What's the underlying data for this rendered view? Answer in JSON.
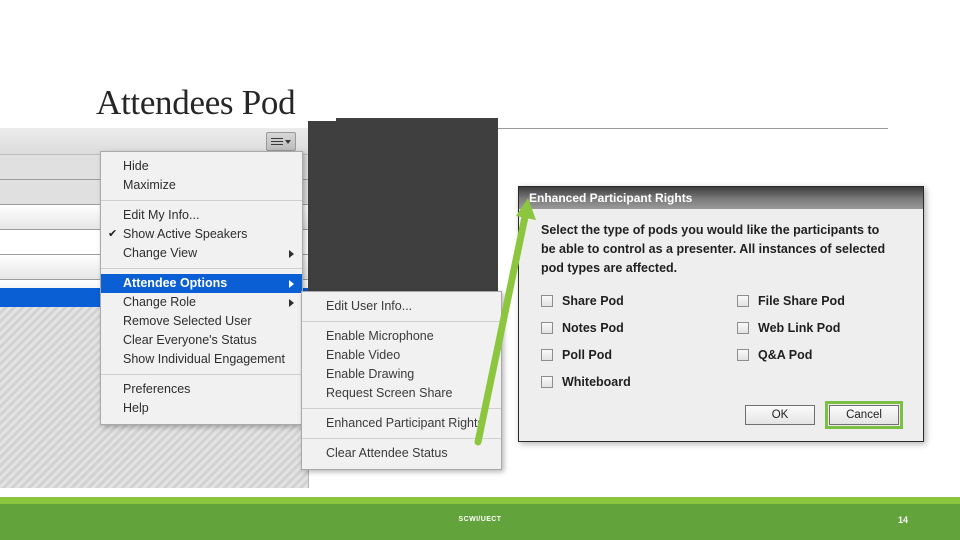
{
  "slide": {
    "title": "Attendees Pod",
    "page_number": "14",
    "footer_center": "SCWI/UECT",
    "accent_color": "#8cc63f",
    "footer_color": "#63a33b",
    "highlight_color": "#0b5fd4"
  },
  "pod_window": {
    "menu_button_icon": "hamburger-menu-icon"
  },
  "context_menu": {
    "groups": [
      {
        "items": [
          {
            "label": "Hide",
            "submenu": false,
            "checked": false,
            "selected": false
          },
          {
            "label": "Maximize",
            "submenu": false,
            "checked": false,
            "selected": false
          }
        ]
      },
      {
        "items": [
          {
            "label": "Edit My Info...",
            "submenu": false,
            "checked": false,
            "selected": false
          },
          {
            "label": "Show Active Speakers",
            "submenu": false,
            "checked": true,
            "selected": false
          },
          {
            "label": "Change View",
            "submenu": true,
            "checked": false,
            "selected": false
          }
        ]
      },
      {
        "items": [
          {
            "label": "Attendee Options",
            "submenu": true,
            "checked": false,
            "selected": true
          },
          {
            "label": "Change Role",
            "submenu": true,
            "checked": false,
            "selected": false
          },
          {
            "label": "Remove Selected User",
            "submenu": false,
            "checked": false,
            "selected": false
          },
          {
            "label": "Clear Everyone's Status",
            "submenu": false,
            "checked": false,
            "selected": false
          },
          {
            "label": "Show Individual Engagement",
            "submenu": false,
            "checked": false,
            "selected": false
          }
        ]
      },
      {
        "items": [
          {
            "label": "Preferences",
            "submenu": false,
            "checked": false,
            "selected": false
          },
          {
            "label": "Help",
            "submenu": false,
            "checked": false,
            "selected": false
          }
        ]
      }
    ]
  },
  "submenu": {
    "groups": [
      {
        "items": [
          {
            "label": "Edit User Info...",
            "submenu": false,
            "selected": false
          }
        ]
      },
      {
        "items": [
          {
            "label": "Enable Microphone",
            "submenu": false,
            "selected": false
          },
          {
            "label": "Enable Video",
            "submenu": false,
            "selected": false
          },
          {
            "label": "Enable Drawing",
            "submenu": false,
            "selected": false
          },
          {
            "label": "Request Screen Share",
            "submenu": false,
            "selected": false
          }
        ]
      },
      {
        "items": [
          {
            "label": "Enhanced Participant Rights",
            "submenu": false,
            "selected": false
          }
        ]
      },
      {
        "items": [
          {
            "label": "Clear Attendee Status",
            "submenu": false,
            "selected": false
          }
        ]
      }
    ]
  },
  "dialog": {
    "title": "Enhanced Participant Rights",
    "description": "Select the type of pods you would like the participants to be able to control as a presenter. All instances of selected pod types are affected.",
    "checkboxes": [
      {
        "label": "Share Pod",
        "checked": false
      },
      {
        "label": "File Share Pod",
        "checked": false
      },
      {
        "label": "Notes Pod",
        "checked": false
      },
      {
        "label": "Web Link Pod",
        "checked": false
      },
      {
        "label": "Poll Pod",
        "checked": false
      },
      {
        "label": "Q&A Pod",
        "checked": false
      },
      {
        "label": "Whiteboard",
        "checked": false
      }
    ],
    "buttons": [
      {
        "label": "OK",
        "focused": false
      },
      {
        "label": "Cancel",
        "focused": true
      }
    ]
  },
  "annotation": {
    "arrow_color": "#8cc63f",
    "icon": "arrow-pointer-icon"
  }
}
